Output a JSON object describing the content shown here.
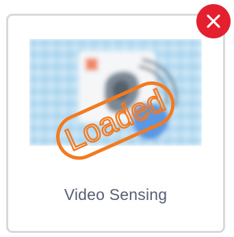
{
  "extension_tile": {
    "title": "Video Sensing",
    "stamp_text": "Loaded",
    "status": "loaded",
    "stamp_color": "#f47a20",
    "remove_button_color": "#e5202e",
    "thumbnail": "video-sensing-thumbnail",
    "remove_icon": "close-icon"
  }
}
